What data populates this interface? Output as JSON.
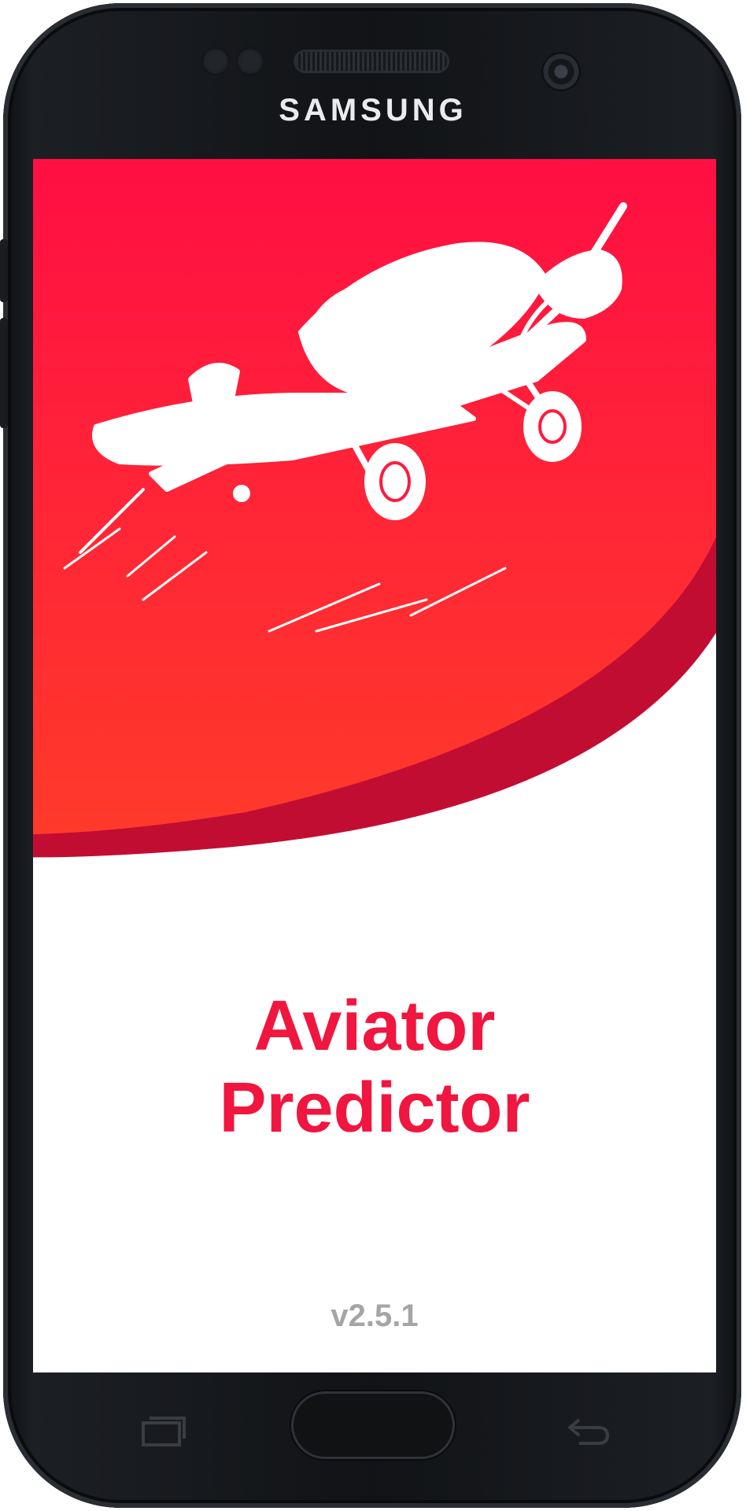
{
  "device": {
    "brand": "SAMSUNG"
  },
  "app": {
    "title_line1": "Aviator",
    "title_line2": "Predictor",
    "version": "v2.5.1"
  },
  "theme": {
    "primary_red": "#f0163f",
    "gradient_top": "#ff0f43",
    "gradient_bottom": "#ff3a2a",
    "curve_shade": "#c20d33",
    "version_gray": "#a5a5a5"
  },
  "icons": {
    "hero": "airplane-icon",
    "recent_apps": "recent-apps-icon",
    "back": "back-icon"
  }
}
